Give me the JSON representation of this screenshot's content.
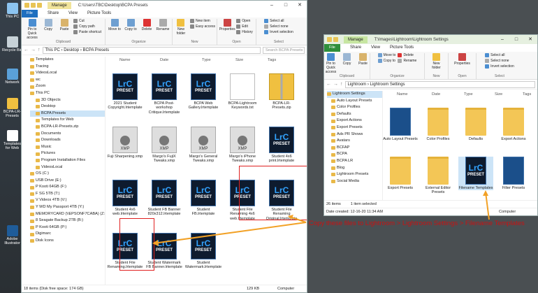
{
  "desktop_icons": [
    "This PC",
    "Recycle Bin",
    "Network",
    "BCPA-LR-Presets",
    "Templates for Web",
    "Adobe Illustrator"
  ],
  "w1": {
    "qat_labels": [],
    "manage": "Manage",
    "title": "C:\\Users\\TBC\\Desktop\\BCPA Presets",
    "tabs": [
      "File",
      "Home",
      "Share",
      "View",
      "Picture Tools"
    ],
    "ribbon": {
      "clipboard": {
        "pin": "Pin to Quick access",
        "copy": "Copy",
        "paste": "Paste",
        "cut": "Cut",
        "copy_path": "Copy path",
        "paste_shortcut": "Paste shortcut",
        "label": "Clipboard"
      },
      "organize": {
        "move": "Move to",
        "copy": "Copy to",
        "delete": "Delete",
        "rename": "Rename",
        "label": "Organize"
      },
      "new": {
        "folder": "New folder",
        "item": "New item",
        "easy": "Easy access",
        "label": "New"
      },
      "open": {
        "properties": "Properties",
        "open": "Open",
        "edit": "Edit",
        "history": "History",
        "label": "Open"
      },
      "select": {
        "all": "Select all",
        "none": "Select none",
        "invert": "Invert selection",
        "label": "Select"
      }
    },
    "path": [
      "This PC",
      "Desktop",
      "BCPA Presets"
    ],
    "search": "Search BCPA Presets",
    "tree": [
      "Templates",
      "Tracing",
      "VideosLocal",
      "wc",
      "Zoom",
      "This PC",
      "3D Objects",
      "Desktop",
      "BCPA Presets",
      "Templates for Web",
      "BCPA-LR-Presets.zip",
      "Documents",
      "Downloads",
      "Music",
      "Pictures",
      "Program Installation Files",
      "VideosLocal",
      "OS (C:)",
      "USB Drive (E:)",
      "P Kooti 64GB (F:)",
      "F SG 5TB (T:)",
      "V Videos 4TB (V:)",
      "Y WD My Passport 4TB (Y:)",
      "MEMORYCARD (\\\\EPSONF7CABA) (Z:)",
      "8 Seagate Backup 2TB (B:)",
      "P Kooti 64GB (P:)",
      "Digimarc",
      "Disk Icons"
    ],
    "columns": [
      "Name",
      "Date",
      "Type",
      "Size",
      "Tags"
    ],
    "files": [
      {
        "type": "lrc",
        "name": "2021 Student Copyright.lrtemplate"
      },
      {
        "type": "lrc",
        "name": "BCPA Post-workshop Critique.lrtemplate"
      },
      {
        "type": "lrc",
        "name": "BCPA Web Gallery.lrtemplate"
      },
      {
        "type": "doc",
        "name": "BCPA-Lightroom Keywords.txt"
      },
      {
        "type": "zip",
        "name": "BCPA-LR-Presets.zip"
      },
      {
        "type": "xmp",
        "name": "Fuji Sharpening.xmp"
      },
      {
        "type": "xmp",
        "name": "Margo's FujiX Tweaks.xmp"
      },
      {
        "type": "xmp",
        "name": "Margo's General Tweaks.xmp"
      },
      {
        "type": "xmp",
        "name": "Margo's iPhone Tweaks.xmp"
      },
      {
        "type": "lrc",
        "name": "Student 4x6 print.lrtemplate"
      },
      {
        "type": "lrc",
        "name": "Student 4x6 web.lrtemplate"
      },
      {
        "type": "lrc",
        "name": "Student FB Banner 820x312.lrtemplate"
      },
      {
        "type": "lrc",
        "name": "Student FB.lrtemplate"
      },
      {
        "type": "lrc",
        "name": "Student File Renaming 4x6 web.lrtemplate"
      },
      {
        "type": "lrc",
        "name": "Student File Renaming Original.lrtemplate"
      },
      {
        "type": "lrc",
        "name": "Student File Renaming.lrtemplate"
      },
      {
        "type": "lrc",
        "name": "Student Watermark FB Banner.lrtemplate"
      },
      {
        "type": "lrc",
        "name": "Student Watermark.lrtemplate"
      }
    ],
    "status_left": "18 items (Disk free space: 174 GB)",
    "status_size": "129 KB",
    "status_right": "Computer"
  },
  "w2": {
    "manage": "Manage",
    "title": "T:\\Images\\Lightroom\\Lightroom Settings",
    "tabs": [
      "File",
      "Home",
      "Share",
      "View",
      "Picture Tools"
    ],
    "ribbon": {
      "clipboard": {
        "pin": "Pin to Quick access",
        "copy": "Copy",
        "paste": "Paste",
        "label": "Clipboard"
      },
      "organize": {
        "move": "Move to",
        "copy": "Copy to",
        "delete": "Delete",
        "rename": "Rename",
        "label": "Organize"
      },
      "new": {
        "folder": "New folder",
        "label": "New"
      },
      "open": {
        "properties": "Properties",
        "label": "Open"
      },
      "select": {
        "all": "Select all",
        "none": "Select none",
        "invert": "Invert selection",
        "label": "Select"
      }
    },
    "path": [
      "Lightroom",
      "Lightroom Settings"
    ],
    "tree": [
      "Lightroom Settings",
      "Auto Layout Presets",
      "Color Profiles",
      "Defaults",
      "Export Actions",
      "Export Presets",
      "Ads PR Shows",
      "Avatars",
      "BCFAP",
      "BCPA",
      "BCPA LR",
      "Blog",
      "Lightroom Presets",
      "Social Media"
    ],
    "columns": [
      "Name",
      "Date",
      "Type",
      "Size",
      "Tags"
    ],
    "files": [
      {
        "type": "book",
        "name": "Auto Layout Presets"
      },
      {
        "type": "folder",
        "name": "Color Profiles"
      },
      {
        "type": "folder",
        "name": "Defaults"
      },
      {
        "type": "folder",
        "name": "Export Actions"
      },
      {
        "type": "folder",
        "name": "Export Presets"
      },
      {
        "type": "folder",
        "name": "External Editor Presets"
      },
      {
        "type": "lrc",
        "name": "Filename Templates"
      },
      {
        "type": "book",
        "name": "Filter Presets"
      }
    ],
    "status_left": "26 items",
    "status_right": "1 item selected",
    "status_date": "Date created: 12-16-20 11:34 AM",
    "status_computer": "Computer"
  },
  "callout": "Copy these files to Lightroom > Lightroom Settings > Filename Templates",
  "colors": {
    "arrow": "#f2a126",
    "callout": "#c91212",
    "box": "#e02020"
  }
}
